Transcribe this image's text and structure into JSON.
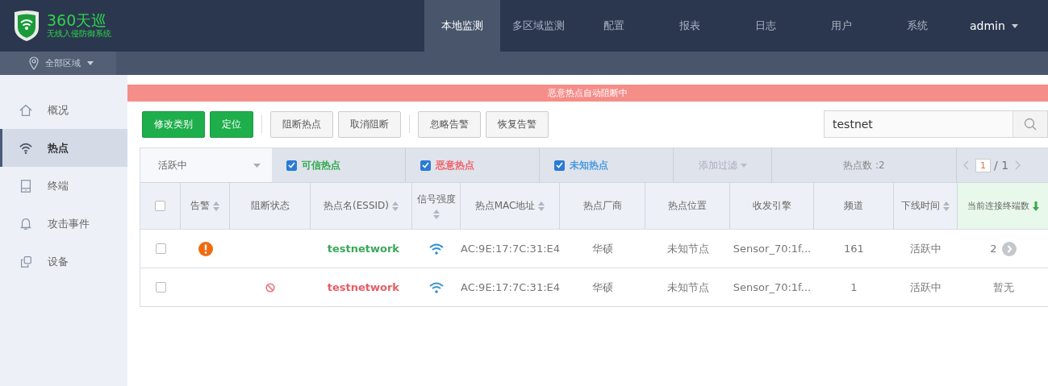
{
  "brand": {
    "name": "360天巡",
    "subtitle": "无线入侵防御系统"
  },
  "nav": [
    {
      "label": "本地监测",
      "selected": true
    },
    {
      "label": "多区域监测",
      "selected": false
    },
    {
      "label": "配置",
      "selected": false
    },
    {
      "label": "报表",
      "selected": false
    },
    {
      "label": "日志",
      "selected": false
    },
    {
      "label": "用户",
      "selected": false
    },
    {
      "label": "系统",
      "selected": false
    }
  ],
  "user": "admin",
  "region": "全部区域",
  "sidebar": [
    {
      "label": "概况",
      "selected": false
    },
    {
      "label": "热点",
      "selected": true
    },
    {
      "label": "终端",
      "selected": false
    },
    {
      "label": "攻击事件",
      "selected": false
    },
    {
      "label": "设备",
      "selected": false
    }
  ],
  "banner": "恶意热点自动阻断中",
  "toolbar": [
    {
      "label": "修改类别",
      "kind": "primary"
    },
    {
      "label": "定位",
      "kind": "primary"
    },
    {
      "label": "阻断热点",
      "kind": "default"
    },
    {
      "label": "取消阻断",
      "kind": "default"
    },
    {
      "label": "忽略告警",
      "kind": "default"
    },
    {
      "label": "恢复告警",
      "kind": "default"
    }
  ],
  "search": {
    "value": "testnet"
  },
  "filters": {
    "status": "活跃中",
    "types": [
      {
        "label": "可信热点",
        "checked": true,
        "color": "#2ea84a"
      },
      {
        "label": "恶意热点",
        "checked": true,
        "color": "#f0606a"
      },
      {
        "label": "未知热点",
        "checked": true,
        "color": "#4a9be0"
      }
    ],
    "add_filter": "添加过滤",
    "count": "热点数 :2",
    "page": "1",
    "pages": "/ 1"
  },
  "table": {
    "all_checked": false,
    "columns": [
      {
        "label": "告警",
        "sortable": true,
        "sorted": false
      },
      {
        "label": "阻断状态",
        "sortable": false,
        "sorted": false
      },
      {
        "label": "热点名(ESSID)",
        "sortable": true,
        "sorted": false
      },
      {
        "label": "信号强度",
        "sortable": true,
        "sorted": false
      },
      {
        "label": "热点MAC地址",
        "sortable": true,
        "sorted": false
      },
      {
        "label": "热点厂商",
        "sortable": false,
        "sorted": false
      },
      {
        "label": "热点位置",
        "sortable": false,
        "sorted": false
      },
      {
        "label": "收发引擎",
        "sortable": false,
        "sorted": false
      },
      {
        "label": "频道",
        "sortable": false,
        "sorted": false
      },
      {
        "label": "下线时间",
        "sortable": true,
        "sorted": false
      },
      {
        "label": "当前连接终端数",
        "sortable": true,
        "sorted": true
      }
    ],
    "rows": [
      {
        "checked": false,
        "alarm": true,
        "blocked": false,
        "essid": "testnetwork",
        "color": "#3aa85a",
        "mac": "AC:9E:17:7C:31:E4",
        "vendor": "华硕",
        "location": "未知节点",
        "engine": "Sensor_70:1f...",
        "channel": "161",
        "offline": "活跃中",
        "clients": "2",
        "has_detail": true
      },
      {
        "checked": false,
        "alarm": false,
        "blocked": true,
        "essid": "testnetwork",
        "color": "#e85c66",
        "mac": "AC:9E:17:7C:31:E4",
        "vendor": "华硕",
        "location": "未知节点",
        "engine": "Sensor_70:1f...",
        "channel": "1",
        "offline": "活跃中",
        "clients": "暂无",
        "has_detail": false
      }
    ]
  }
}
